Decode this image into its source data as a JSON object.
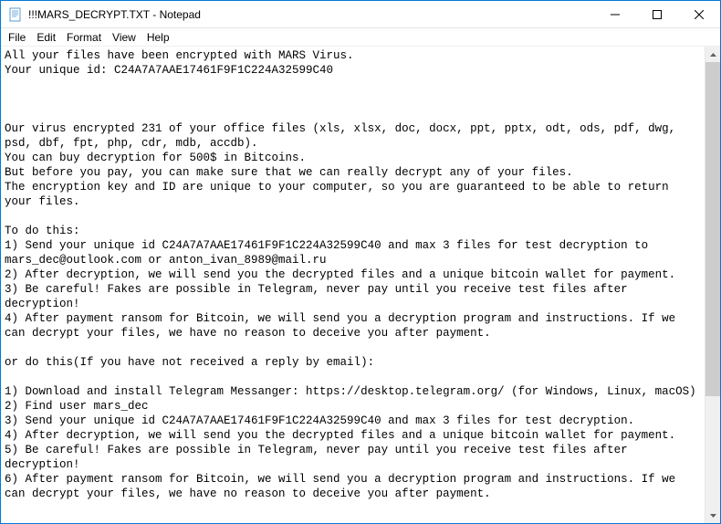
{
  "window": {
    "title": "!!!MARS_DECRYPT.TXT - Notepad"
  },
  "menubar": {
    "items": [
      "File",
      "Edit",
      "Format",
      "View",
      "Help"
    ]
  },
  "document": {
    "content": "All your files have been encrypted with MARS Virus.\nYour unique id: C24A7A7AAE17461F9F1C224A32599C40\n\n\n\nOur virus encrypted 231 of your office files (xls, xlsx, doc, docx, ppt, pptx, odt, ods, pdf, dwg, psd, dbf, fpt, php, cdr, mdb, accdb).\nYou can buy decryption for 500$ in Bitcoins.\nBut before you pay, you can make sure that we can really decrypt any of your files.\nThe encryption key and ID are unique to your computer, so you are guaranteed to be able to return your files.\n\nTo do this:\n1) Send your unique id C24A7A7AAE17461F9F1C224A32599C40 and max 3 files for test decryption to mars_dec@outlook.com or anton_ivan_8989@mail.ru\n2) After decryption, we will send you the decrypted files and a unique bitcoin wallet for payment.\n3) Be careful! Fakes are possible in Telegram, never pay until you receive test files after decryption!\n4) After payment ransom for Bitcoin, we will send you a decryption program and instructions. If we can decrypt your files, we have no reason to deceive you after payment.\n\nor do this(If you have not received a reply by email):\n\n1) Download and install Telegram Messanger: https://desktop.telegram.org/ (for Windows, Linux, macOS)\n2) Find user mars_dec\n3) Send your unique id C24A7A7AAE17461F9F1C224A32599C40 and max 3 files for test decryption.\n4) After decryption, we will send you the decrypted files and a unique bitcoin wallet for payment.\n5) Be careful! Fakes are possible in Telegram, never pay until you receive test files after decryption!\n6) After payment ransom for Bitcoin, we will send you a decryption program and instructions. If we can decrypt your files, we have no reason to deceive you after payment."
  }
}
